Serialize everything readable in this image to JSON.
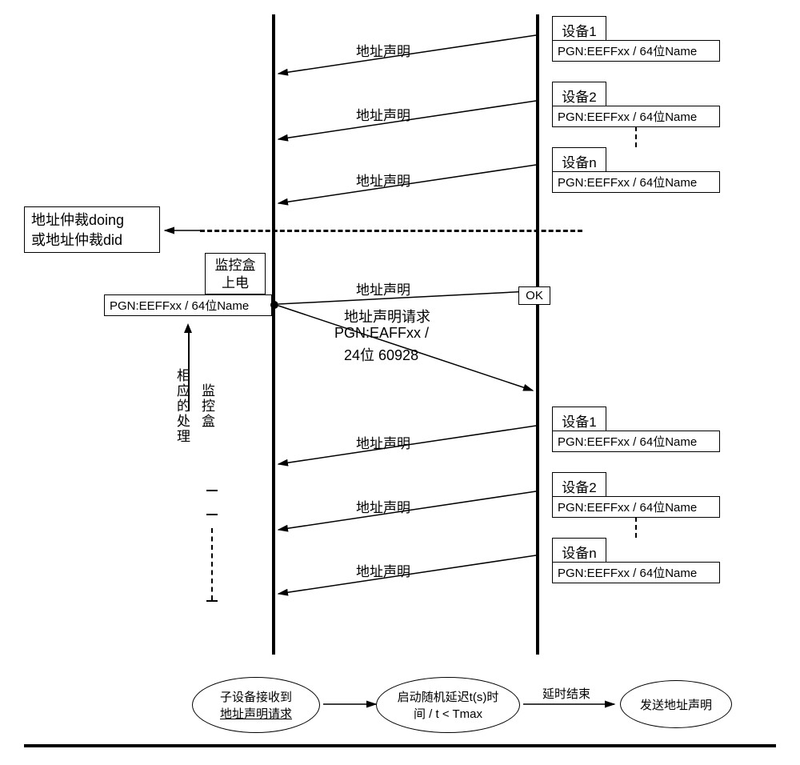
{
  "devices_top": [
    {
      "name": "设备1",
      "detail": "PGN:EEFFxx / 64位Name"
    },
    {
      "name": "设备2",
      "detail": "PGN:EEFFxx / 64位Name"
    },
    {
      "name": "设备n",
      "detail": "PGN:EEFFxx / 64位Name"
    }
  ],
  "devices_bottom": [
    {
      "name": "设备1",
      "detail": "PGN:EEFFxx / 64位Name"
    },
    {
      "name": "设备2",
      "detail": "PGN:EEFFxx / 64位Name"
    },
    {
      "name": "设备n",
      "detail": "PGN:EEFFxx / 64位Name"
    }
  ],
  "address_claim_label": "地址声明",
  "arbitration_box": {
    "line1": "地址仲裁doing",
    "line2": "或地址仲裁did"
  },
  "monitor_box": {
    "line1": "监控盒",
    "line2": "上电",
    "detail": "PGN:EEFFxx / 64位Name"
  },
  "ok_label": "OK",
  "address_claim_request": {
    "l1": "地址声明请求",
    "l2": "PGN:EAFFxx /",
    "l3": "24位 60928"
  },
  "vertical_annotation": {
    "col1": "相应的处理",
    "col2": "监控盒"
  },
  "flow": {
    "step1": {
      "l1": "子设备接收到",
      "l2": "地址声明请求"
    },
    "step2": {
      "l1": "启动随机延迟t(s)时",
      "l2": "间 / t < Tmax"
    },
    "connector": "延时结束",
    "step3": "发送地址声明"
  }
}
